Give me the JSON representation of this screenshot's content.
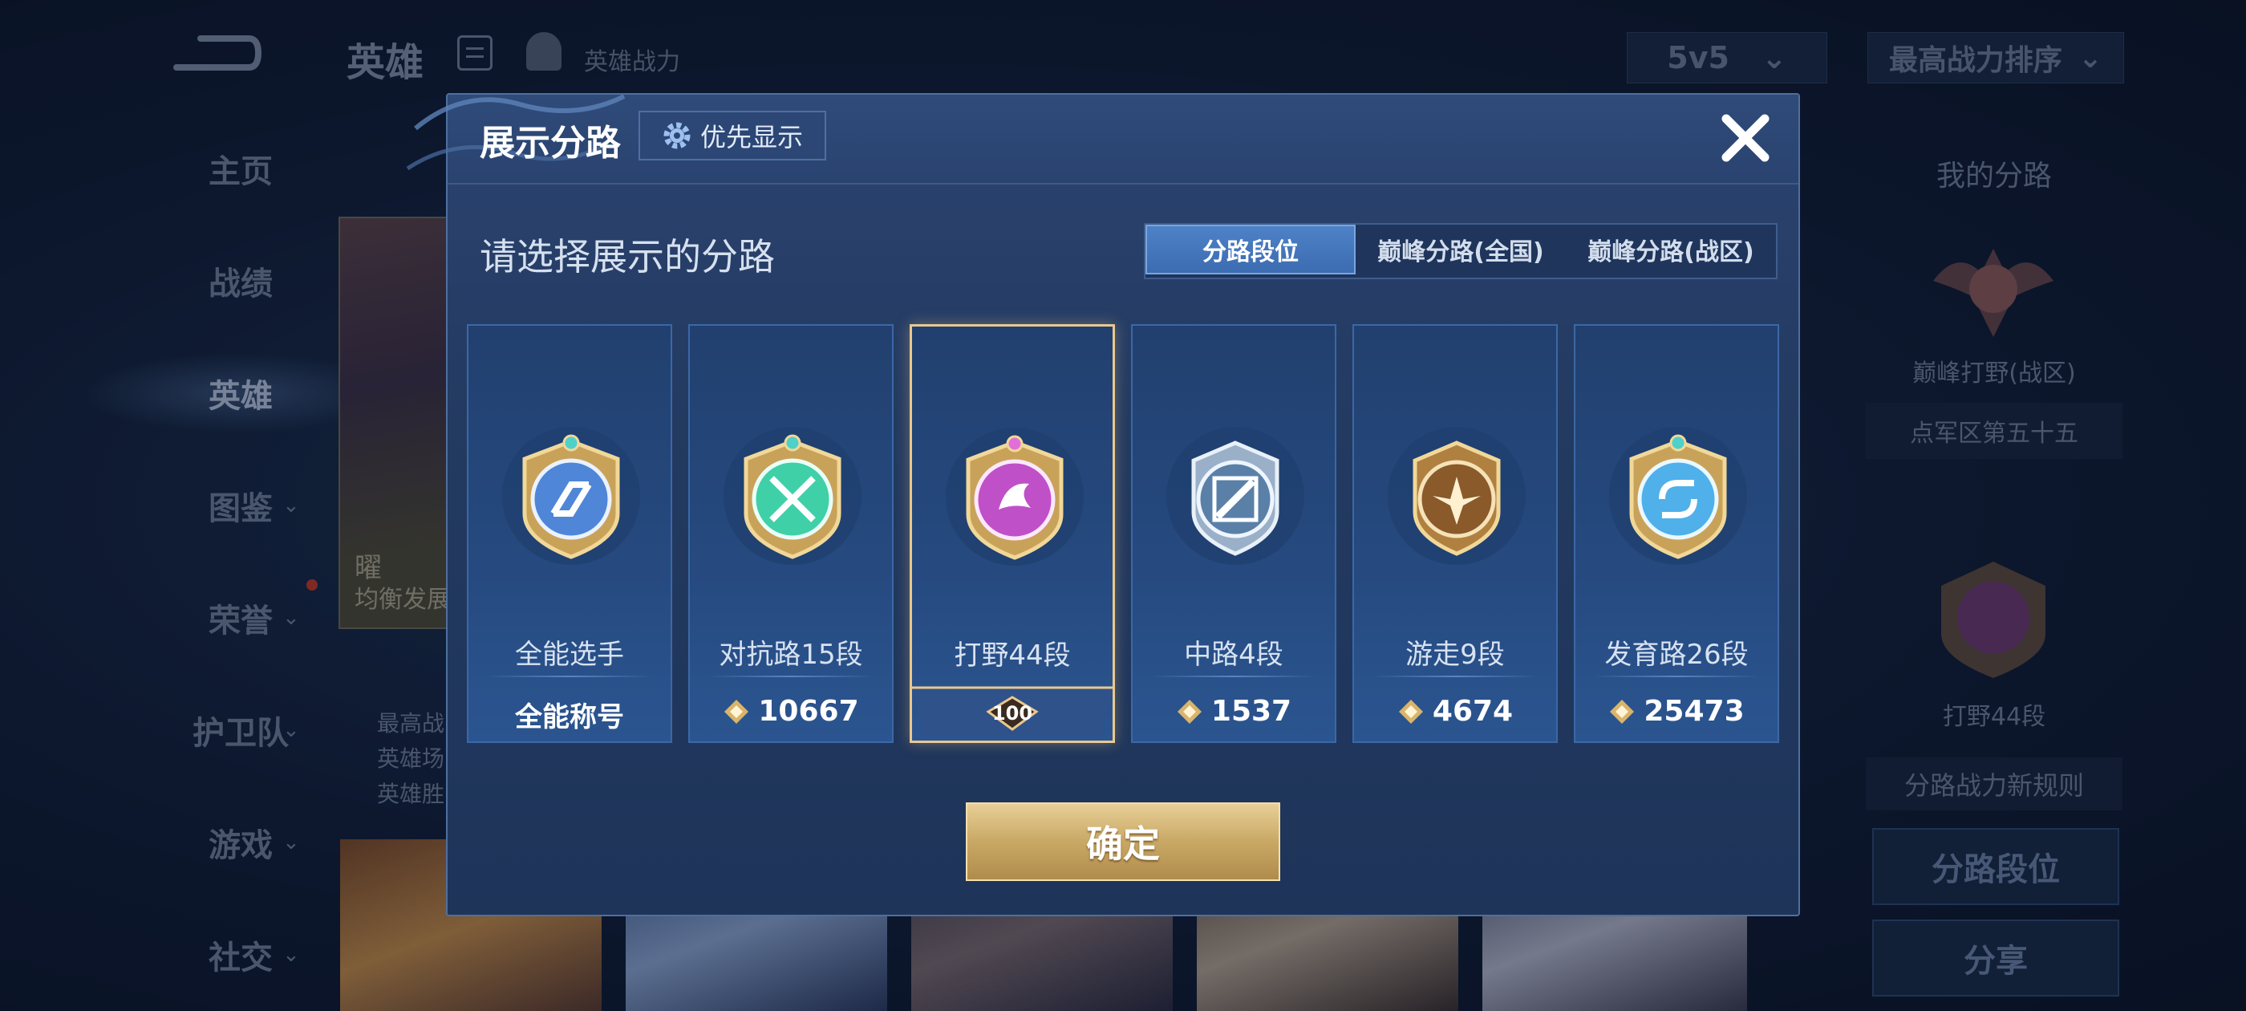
{
  "top_bar": {
    "title": "英雄",
    "power_label": "英雄战力",
    "mode": "5v5",
    "sort": "最高战力排序"
  },
  "sidebar": {
    "items": [
      {
        "label": "主页"
      },
      {
        "label": "战绩"
      },
      {
        "label": "英雄"
      },
      {
        "label": "图鉴"
      },
      {
        "label": "荣誉"
      },
      {
        "label": "护卫队"
      },
      {
        "label": "游戏"
      },
      {
        "label": "社交"
      }
    ]
  },
  "hero_card": {
    "name": "曜",
    "subtitle": "均衡发展"
  },
  "hero_info": {
    "lines": [
      "最高战",
      "英雄场",
      "英雄胜"
    ]
  },
  "right_panel": {
    "title": "我的分路",
    "peak_label": "巅峰打野(战区)",
    "area_label": "点军区第五十五",
    "lane_label": "打野44段",
    "rule_label": "分路战力新规则",
    "rank_button": "分路段位",
    "share_button": "分享"
  },
  "modal": {
    "title": "展示分路",
    "priority_button": "优先显示",
    "subtitle": "请选择展示的分路",
    "tabs": [
      "分路段位",
      "巅峰分路(全国)",
      "巅峰分路(战区)"
    ],
    "active_tab": "分路段位",
    "cards": [
      {
        "name": "全能选手",
        "value": "全能称号",
        "icon": "all-round-emblem",
        "color": "#4f86d8"
      },
      {
        "name": "对抗路15段",
        "value": "10667",
        "icon": "clash-lane-emblem",
        "color": "#3fd0a8"
      },
      {
        "name": "打野44段",
        "value": "100",
        "icon": "jungle-emblem",
        "color": "#c050c8",
        "selected": true
      },
      {
        "name": "中路4段",
        "value": "1537",
        "icon": "mid-lane-emblem",
        "color": "#8fb4d8"
      },
      {
        "name": "游走9段",
        "value": "4674",
        "icon": "roam-emblem",
        "color": "#c28a45"
      },
      {
        "name": "发育路26段",
        "value": "25473",
        "icon": "farm-lane-emblem",
        "color": "#4fb0ea"
      }
    ],
    "confirm_button": "确定"
  }
}
